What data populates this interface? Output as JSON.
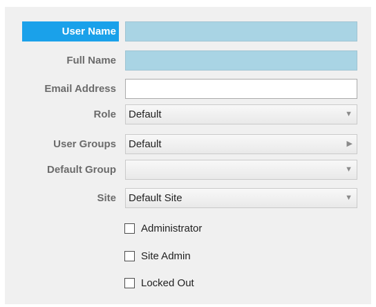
{
  "form": {
    "fields": [
      {
        "label": "User Name",
        "value": ""
      },
      {
        "label": "Full Name",
        "value": ""
      },
      {
        "label": "Email Address",
        "value": ""
      },
      {
        "label": "Role",
        "value": "Default"
      },
      {
        "label": "User Groups",
        "value": "Default"
      },
      {
        "label": "Default Group",
        "value": ""
      },
      {
        "label": "Site",
        "value": "Default Site"
      }
    ],
    "checkboxes": [
      {
        "label": "Administrator",
        "checked": false
      },
      {
        "label": "Site Admin",
        "checked": false
      },
      {
        "label": "Locked Out",
        "checked": false
      }
    ]
  },
  "icons": {
    "dropdown": "chevron-down-icon",
    "expand": "chevron-right-icon"
  },
  "colors": {
    "active_label_bg": "#1aa1ea",
    "required_field_bg": "#a9d4e4",
    "label_text": "#6b6b6b"
  }
}
